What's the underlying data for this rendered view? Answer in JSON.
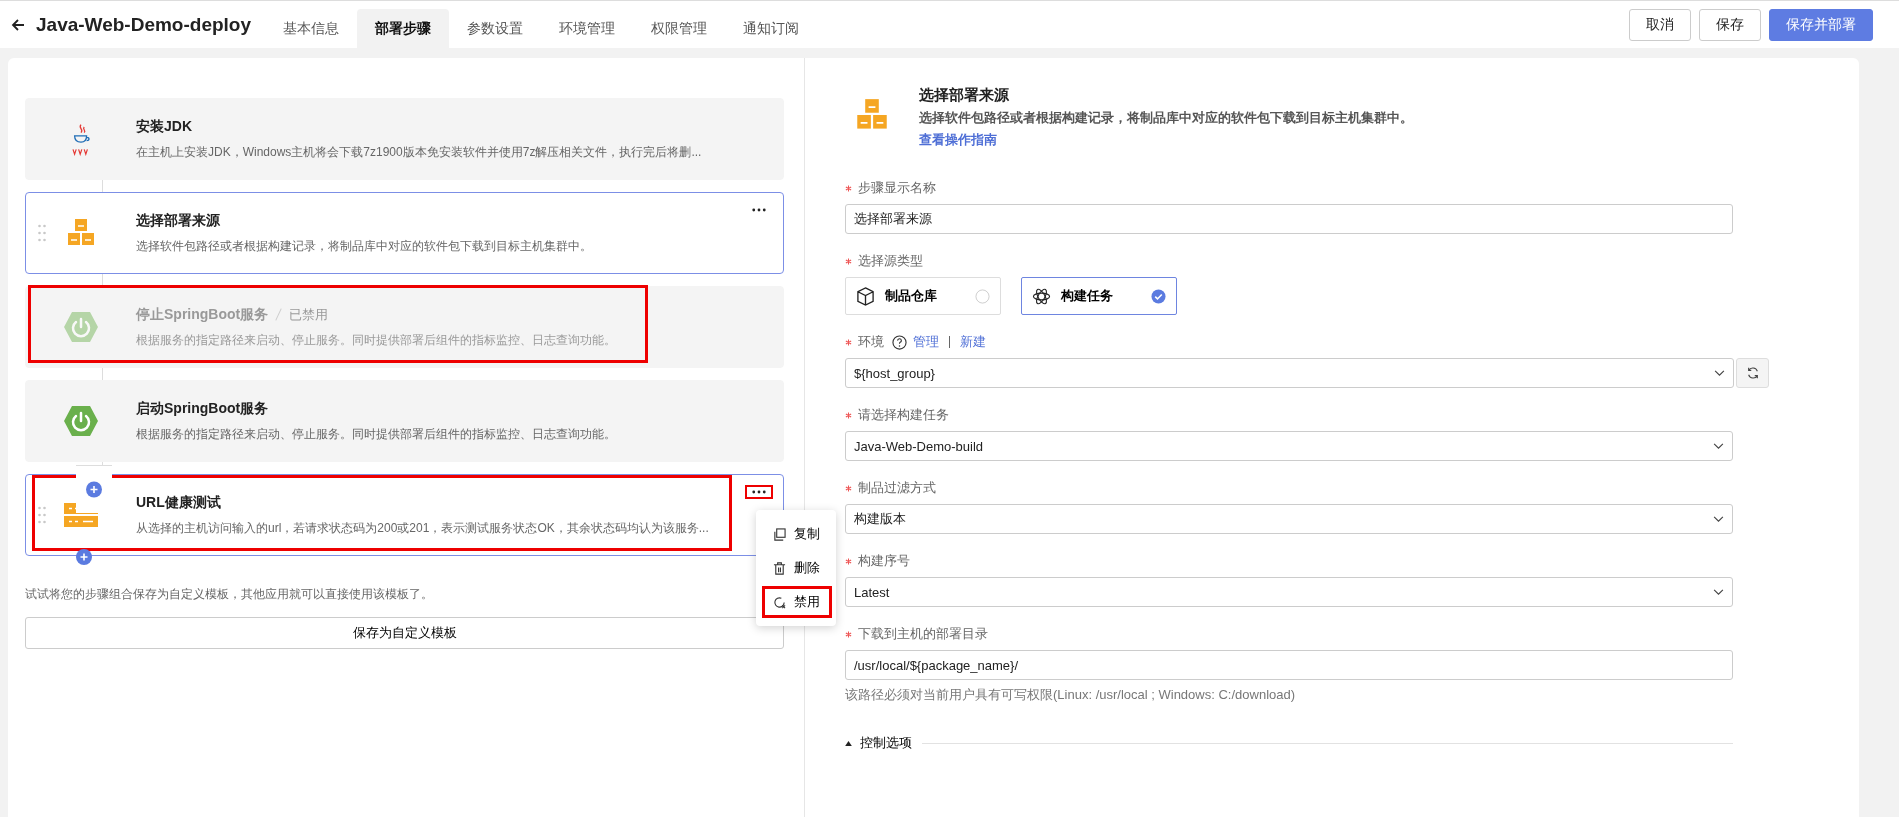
{
  "header": {
    "title": "Java-Web-Demo-deploy",
    "tabs": [
      {
        "label": "基本信息",
        "selected": false
      },
      {
        "label": "部署步骤",
        "selected": true
      },
      {
        "label": "参数设置",
        "selected": false
      },
      {
        "label": "环境管理",
        "selected": false
      },
      {
        "label": "权限管理",
        "selected": false
      },
      {
        "label": "通知订阅",
        "selected": false
      }
    ],
    "buttons": [
      {
        "label": "取消",
        "kind": "default"
      },
      {
        "label": "保存",
        "kind": "default"
      },
      {
        "label": "保存并部署",
        "kind": "primary"
      }
    ]
  },
  "steps": [
    {
      "kind": "java",
      "title": "安装JDK",
      "description": "在主机上安装JDK，Windows主机将会下载7z1900版本免安装软件并使用7z解压相关文件，执行完后将删...",
      "selected": false,
      "disabled": false,
      "show_more": false,
      "highlighted": false
    },
    {
      "kind": "boxes",
      "title": "选择部署来源",
      "description": "选择软件包路径或者根据构建记录，将制品库中对应的软件包下载到目标主机集群中。",
      "selected": true,
      "disabled": false,
      "show_more": true,
      "highlighted": false
    },
    {
      "kind": "spring",
      "title": "停止SpringBoot服务",
      "status": "已禁用",
      "description": "根据服务的指定路径来启动、停止服务。同时提供部署后组件的指标监控、日志查询功能。",
      "selected": false,
      "disabled": true,
      "show_more": false,
      "highlighted": true
    },
    {
      "kind": "spring",
      "title": "启动SpringBoot服务",
      "description": "根据服务的指定路径来启动、停止服务。同时提供部署后组件的指标监控、日志查询功能。",
      "selected": false,
      "disabled": false,
      "show_more": false,
      "highlighted": false
    },
    {
      "kind": "server",
      "title": "URL健康测试",
      "description": "从选择的主机访问输入的url，若请求状态码为200或201，表示测试服务状态OK，其余状态码均认为该服务...",
      "selected": true,
      "disabled": false,
      "show_more": true,
      "highlighted": true,
      "more_highlighted": true,
      "menu": [
        {
          "kind": "copy",
          "label": "复制",
          "highlighted": false
        },
        {
          "kind": "delete",
          "label": "删除",
          "highlighted": false
        },
        {
          "kind": "disable",
          "label": "禁用",
          "highlighted": true
        }
      ]
    }
  ],
  "template_hint": "试试将您的步骤组合保存为自定义模板，其他应用就可以直接使用该模板了。",
  "template_button": "保存为自定义模板",
  "detail": {
    "title": "选择部署来源",
    "description": "选择软件包路径或者根据构建记录，将制品库中对应的软件包下载到目标主机集群中。",
    "link": "查看操作指南"
  },
  "fields": [
    {
      "kind": "input",
      "label": "步骤显示名称",
      "required": true,
      "value": "选择部署来源"
    },
    {
      "kind": "choice",
      "label": "选择源类型",
      "required": true,
      "options": [
        {
          "kind": "repository",
          "label": "制品仓库",
          "selected": false
        },
        {
          "kind": "build",
          "label": "构建任务",
          "selected": true
        }
      ]
    },
    {
      "kind": "select",
      "label": "环境",
      "required": true,
      "help": true,
      "links": [
        "管理",
        "新建"
      ],
      "value": "${host_group}",
      "refresh": true
    },
    {
      "kind": "select",
      "label": "请选择构建任务",
      "required": true,
      "value": "Java-Web-Demo-build"
    },
    {
      "kind": "select",
      "label": "制品过滤方式",
      "required": true,
      "value": "构建版本"
    },
    {
      "kind": "select",
      "label": "构建序号",
      "required": true,
      "value": "Latest"
    },
    {
      "kind": "input",
      "label": "下载到主机的部署目录",
      "required": true,
      "value": "/usr/local/${package_name}/",
      "hint": "该路径必须对当前用户具有可写权限(Linux: /usr/local ; Windows: C:/download)"
    }
  ],
  "control_section": {
    "label": "控制选项",
    "expanded": true
  }
}
